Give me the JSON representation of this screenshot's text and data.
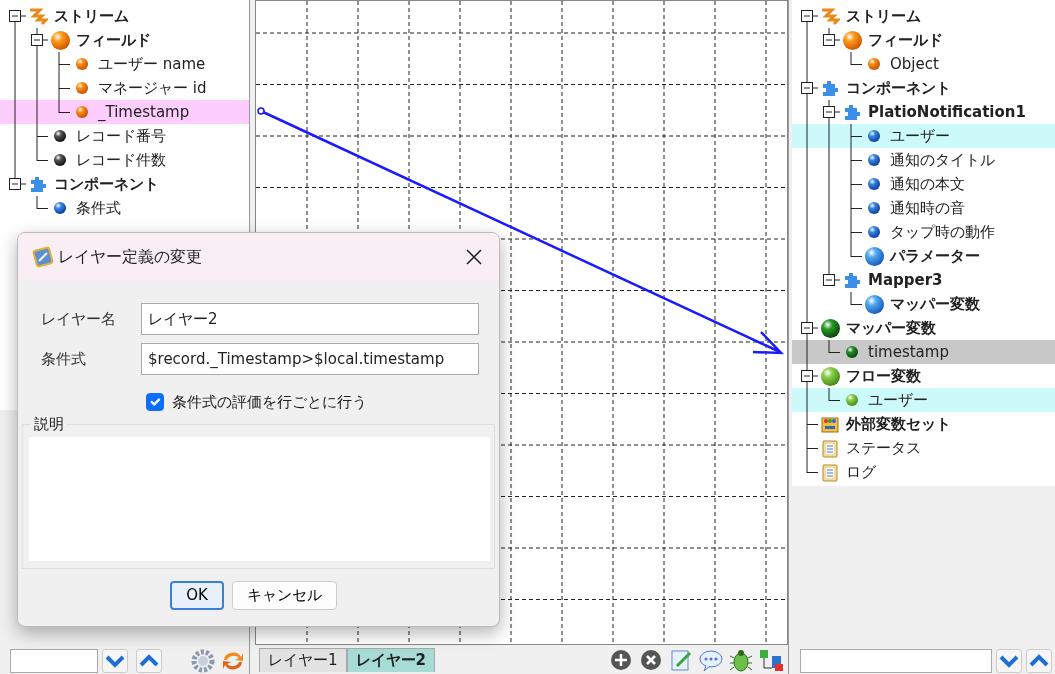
{
  "left_tree": {
    "items": [
      {
        "label": "ストリーム",
        "kind": "stream",
        "expanded": true,
        "children": [
          {
            "label": "フィールド",
            "kind": "field-group",
            "expanded": true,
            "children": [
              {
                "label": "ユーザー name",
                "kind": "field"
              },
              {
                "label": "マネージャー id",
                "kind": "field"
              },
              {
                "label": "_Timestamp",
                "kind": "field",
                "color": "#fdcdfd"
              }
            ]
          },
          {
            "label": "レコード番号",
            "kind": "record"
          },
          {
            "label": "レコード件数",
            "kind": "record"
          }
        ]
      },
      {
        "label": "コンポーネント",
        "kind": "component",
        "expanded": true,
        "children": [
          {
            "label": "条件式",
            "kind": "property"
          }
        ]
      }
    ]
  },
  "canvas": {
    "tabs": [
      {
        "label": "レイヤー1",
        "selected": false
      },
      {
        "label": "レイヤー2",
        "selected": true
      }
    ]
  },
  "right_tree": {
    "items": [
      {
        "label": "ストリーム",
        "kind": "stream",
        "expanded": true,
        "children": [
          {
            "label": "フィールド",
            "kind": "field-group",
            "expanded": true,
            "children": [
              {
                "label": "Object",
                "kind": "field"
              }
            ]
          }
        ]
      },
      {
        "label": "コンポーネント",
        "kind": "component",
        "expanded": true,
        "children": [
          {
            "label": "PlatioNotification1",
            "kind": "component",
            "expanded": true,
            "children": [
              {
                "label": "ユーザー",
                "kind": "property",
                "color": "#ccfafa"
              },
              {
                "label": "通知のタイトル",
                "kind": "property"
              },
              {
                "label": "通知の本文",
                "kind": "property"
              },
              {
                "label": "通知時の音",
                "kind": "property"
              },
              {
                "label": "タップ時の動作",
                "kind": "property"
              },
              {
                "label": "パラメーター",
                "kind": "parameter"
              }
            ]
          },
          {
            "label": "Mapper3",
            "kind": "component",
            "expanded": true,
            "children": [
              {
                "label": "マッパー変数",
                "kind": "parameter"
              }
            ]
          }
        ]
      },
      {
        "label": "マッパー変数",
        "kind": "variable-group",
        "expanded": true,
        "children": [
          {
            "label": "timestamp",
            "kind": "variable",
            "color": "#c8c8c8"
          }
        ]
      },
      {
        "label": "フロー変数",
        "kind": "flow-group",
        "expanded": true,
        "children": [
          {
            "label": "ユーザー",
            "kind": "flow-variable",
            "color": "#ccfafa"
          }
        ]
      },
      {
        "label": "外部変数セット",
        "kind": "external-set"
      },
      {
        "label": "ステータス",
        "kind": "document"
      },
      {
        "label": "ログ",
        "kind": "document"
      }
    ]
  },
  "dialog": {
    "title": "レイヤー定義の変更",
    "fields": [
      {
        "label": "レイヤー名",
        "value": "レイヤー2"
      },
      {
        "label": "条件式",
        "value": "$record._Timestamp>$local.timestamp"
      }
    ],
    "checkbox": {
      "label": "条件式の評価を行ごとに行う",
      "checked": true
    },
    "description": {
      "legend": "説明"
    },
    "buttons": [
      {
        "label": "OK",
        "default": true
      },
      {
        "label": "キャンセル",
        "default": false
      }
    ]
  }
}
